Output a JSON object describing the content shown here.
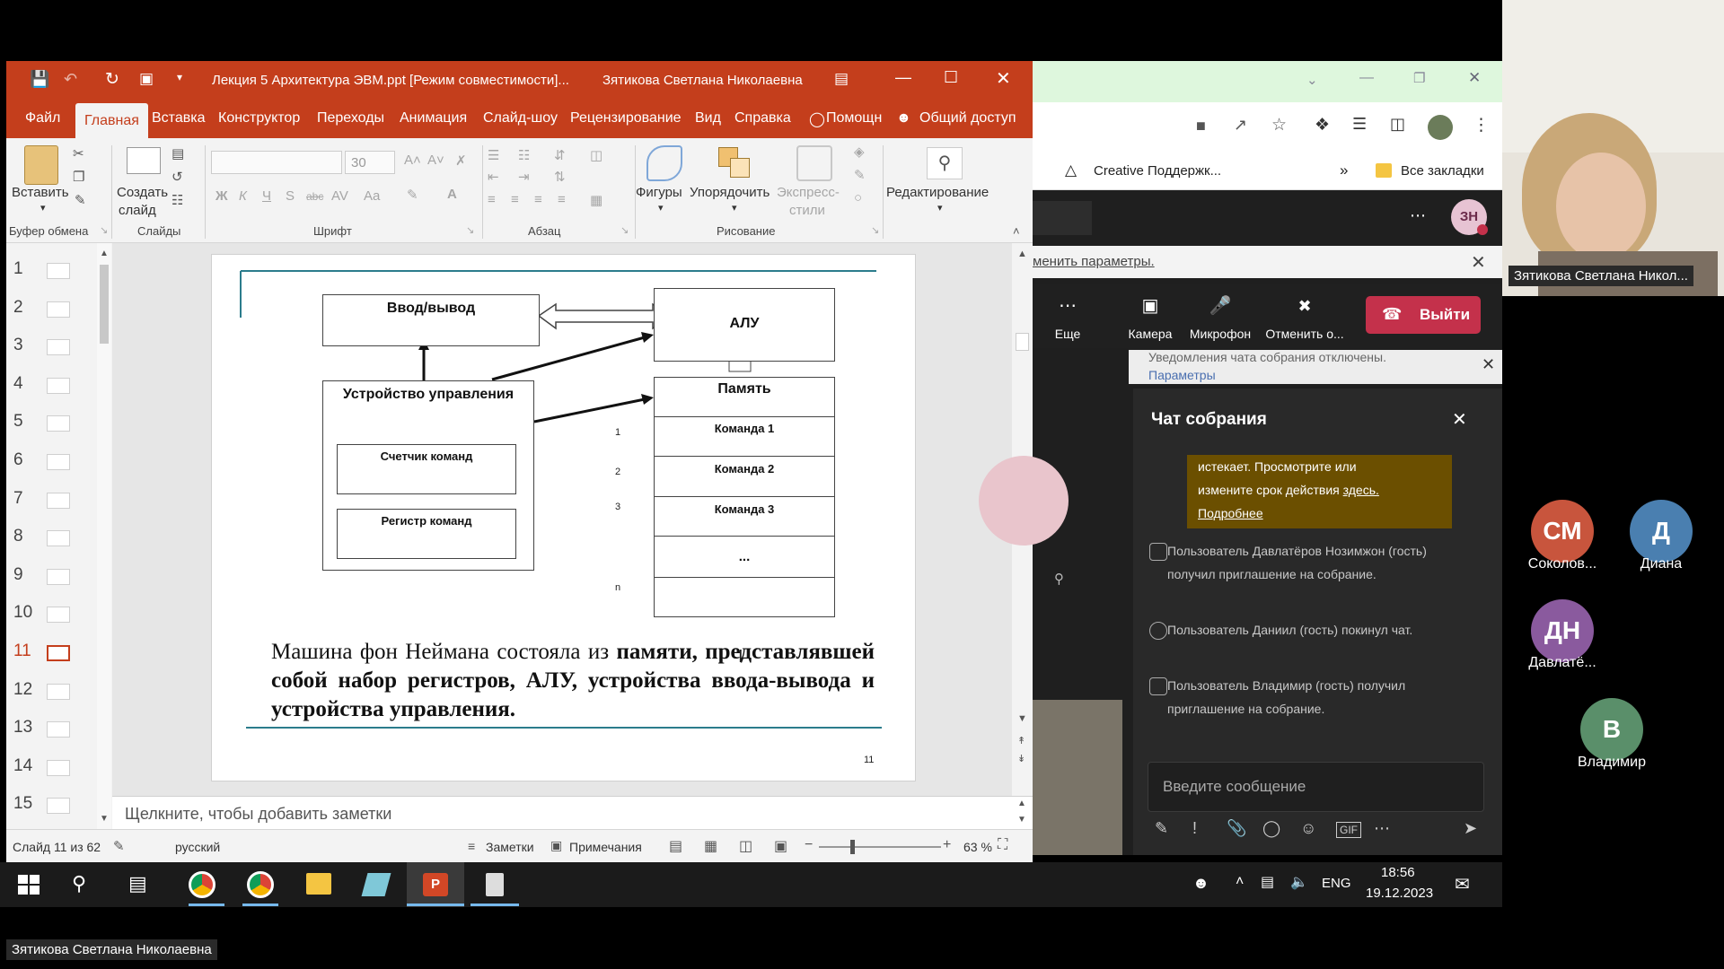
{
  "powerpoint": {
    "title": "Лекция 5 Архитектура ЭВМ.ppt [Режим совместимости]...",
    "user": "Зятикова Светлана Николаевна",
    "menu": [
      "Файл",
      "Главная",
      "Вставка",
      "Конструктор",
      "Переходы",
      "Анимация",
      "Слайд-шоу",
      "Рецензирование",
      "Вид",
      "Справка",
      "Помощн",
      "Общий доступ"
    ],
    "ribbon": {
      "paste": "Вставить",
      "new_slide_1": "Создать",
      "new_slide_2": "слайд",
      "font_size": "30",
      "shapes": "Фигуры",
      "arrange": "Упорядочить",
      "express_1": "Экспресс-",
      "express_2": "стили",
      "editing": "Редактирование",
      "groups": [
        "Буфер обмена",
        "Слайды",
        "Шрифт",
        "Абзац",
        "Рисование"
      ],
      "format_letters": [
        "Ж",
        "К",
        "Ч",
        "S",
        "abc",
        "AV",
        "Aa"
      ]
    },
    "thumbs": [
      "1",
      "2",
      "3",
      "4",
      "5",
      "6",
      "7",
      "8",
      "9",
      "10",
      "11",
      "12",
      "13",
      "14",
      "15"
    ],
    "slide": {
      "io": "Ввод/вывод",
      "alu": "АЛУ",
      "control": "Устройство управления",
      "counter": "Счетчик команд",
      "register": "Регистр команд",
      "memory": "Память",
      "cmd1": "Команда 1",
      "cmd2": "Команда 2",
      "cmd3": "Команда 3",
      "dots": "...",
      "rows": [
        "1",
        "2",
        "3",
        "n"
      ],
      "text_normal": "Машина фон Неймана состояла из",
      "text_bold": "памяти, представлявшей собой набор регистров, АЛУ, устройства ввода-вывода и устройства управления.",
      "page_number": "11"
    },
    "notes_placeholder": "Щелкните, чтобы добавить заметки",
    "status": {
      "slide": "Слайд 11 из 62",
      "lang": "русский",
      "notes": "Заметки",
      "comments": "Примечания",
      "zoom": "63 %"
    }
  },
  "browser": {
    "bookmark": "Creative Поддержк...",
    "more": "»",
    "all_bookmarks": "Все закладки"
  },
  "teams": {
    "notice": "менить параметры.",
    "more": "Еще",
    "camera": "Камера",
    "mic": "Микрофон",
    "cancel": "Отменить о...",
    "leave": "Выйти",
    "banner_text": "Уведомления чата собрания отключены.",
    "banner_link": "Параметры",
    "chat_title": "Чат собрания",
    "gold_line1": "истекает. Просмотрите или",
    "gold_line2": "измените срок действия",
    "gold_link1": "здесь.",
    "gold_link2": "Подробнее",
    "msg1": "Пользователь Давлатёров Нозимжон (гость) получил приглашение на собрание.",
    "msg2": "Пользователь Даниил (гость) покинул чат.",
    "msg3": "Пользователь Владимир (гость) получил приглашение на собрание.",
    "input_placeholder": "Введите сообщение",
    "user_badge": "ЗН"
  },
  "taskbar": {
    "lang": "ENG",
    "time": "18:56",
    "date": "19.12.2023"
  },
  "participants": {
    "presenter_tag": "Зятикова Светлана Никол...",
    "bottom_tag": "Зятикова Светлана Николаевна",
    "list": [
      {
        "initials": "СМ",
        "name": "Соколов...",
        "color": "#c8553d"
      },
      {
        "initials": "Д",
        "name": "Диана",
        "color": "#4a7fb0"
      },
      {
        "initials": "ДН",
        "name": "Давлатё...",
        "color": "#8a5a9e"
      },
      {
        "initials": "В",
        "name": "Владимир",
        "color": "#5a8f6a"
      }
    ]
  }
}
